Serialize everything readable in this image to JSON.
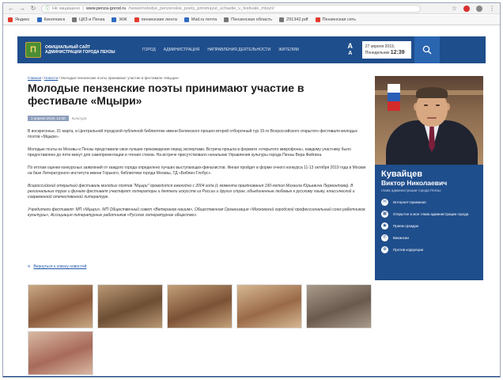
{
  "browser": {
    "url_host": "www.penza-gorod.ru",
    "url_path": "/news/molodye_penzenskie_poety_prinimayut_uchastie_v_festivale_mtsyri/",
    "url_prefix": "Не защищено",
    "bookmarks": [
      {
        "label": "Яндекс",
        "color": "#e23b2e"
      },
      {
        "label": "Кинопоиск",
        "color": "#2d6ac2"
      },
      {
        "label": "ЦКЗ и Пенза",
        "color": "#777777"
      },
      {
        "label": "ЖЖ",
        "color": "#2d6ac2"
      },
      {
        "label": "пензенские лента",
        "color": "#e23b2e"
      },
      {
        "label": "Mail.ru почта",
        "color": "#2d6ac2"
      },
      {
        "label": "Пензенская область",
        "color": "#777777"
      },
      {
        "label": "291342.pdf",
        "color": "#777777"
      },
      {
        "label": "Пензенская сеть",
        "color": "#e23b2e"
      }
    ]
  },
  "header": {
    "logo_text": "П",
    "site_name": "ОФИЦИАЛЬНЫЙ САЙТ АДМИНИСТРАЦИИ ГОРОДА ПЕНЗЫ",
    "nav": [
      "ГОРОД",
      "АДМИНИСТРАЦИЯ",
      "НАПРАВЛЕНИЯ ДЕЯТЕЛЬНОСТИ",
      "ЖИТЕЛЯМ"
    ],
    "font_big": "А",
    "font_small": "А",
    "date": "27 апреля 2019,",
    "weekday": "Понедельник",
    "time": "12:39"
  },
  "breadcrumb": {
    "home": "Главная",
    "news": "Новости",
    "current": "Молодые пензенские поэты принимают участие в фестивале «Мцыри»"
  },
  "article": {
    "title": "Молодые пензенские поэты принимают участие в фестивале «Мцыри»",
    "date": "1 апреля 2019, 13:30",
    "tag": "Культура",
    "paragraphs": [
      "В воскресенье, 31 марта, в Центральной городской публичной библиотеке имени Белинского прошел второй отборочный тур 15-го Всероссийского открытого фестиваля молодых поэтов «Мцыри».",
      "Молодые поэты из Москвы и Пензы представили свои лучшие произведения перед экспертами. Встреча прошла в формате «открытого микрофона», каждому участнику было предоставлено до пяти минут для самопрезентации и чтения стихов. На встрече присутствовало начальник Управления культуры города Пензы Вера Фейгина.",
      "По итогам оценки конкурсных заявлений от каждого города определено лучших выступающих-финалистов. Финал пройдет в форме очного конкурса 11-13 октября 2019 года в Москве на базе Литературного института имени Горького, библиотеки города Москвы, ТД «Библио-Глобус».",
      "Всероссийский открытый фестиваль молодых поэтов \"Мцыри\" проводится ежегодно с 2004 года (с момента празднования 190-летия Михаила Юрьевича Лермонтова). В региональных турах и финале фестиваля участвуют литераторы и деятели искусств из России и других стран, объединенные любовью к русскому языку, классической и современной отечественной литературе.",
      "Учредители фестиваля: МП «Мцыри», МП Общественный совет «Ветеранов нашим», Общественная Организация «Московский городской профессиональный союз работников культуры», Ассоциация литературных работников «Русское литературное общество»."
    ],
    "back_link": "Вернуться к списку новостей"
  },
  "gallery": {
    "photos": [
      {
        "color_a": "#8a5a3c",
        "color_b": "#c9a985"
      },
      {
        "color_a": "#6e4e34",
        "color_b": "#b89874"
      },
      {
        "color_a": "#7c5236",
        "color_b": "#c3a07a"
      },
      {
        "color_a": "#9a6a48",
        "color_b": "#d6b893"
      },
      {
        "color_a": "#6a5a4e",
        "color_b": "#a99b8c"
      },
      {
        "color_a": "#a86a5a",
        "color_b": "#d9b9a3"
      }
    ]
  },
  "sidebar": {
    "surname": "Кувайцев",
    "given_name": "Виктор Николаевич",
    "role": "глава администрации города Пензы",
    "links": [
      {
        "icon": "chat-icon",
        "glyph": "✉",
        "label": "Интернет-приемная"
      },
      {
        "icon": "calendar-icon",
        "glyph": "▦",
        "label": "Открытое и мое глава администрации города"
      },
      {
        "icon": "reception-icon",
        "glyph": "◉",
        "label": "Прием граждан"
      },
      {
        "icon": "phone-icon",
        "glyph": "✆",
        "label": "Вакансии"
      },
      {
        "icon": "anticorruption-icon",
        "glyph": "⊘",
        "label": "Против коррупции"
      }
    ]
  },
  "colors": {
    "brand": "#1f4e8c",
    "accent": "#2a65b0"
  }
}
